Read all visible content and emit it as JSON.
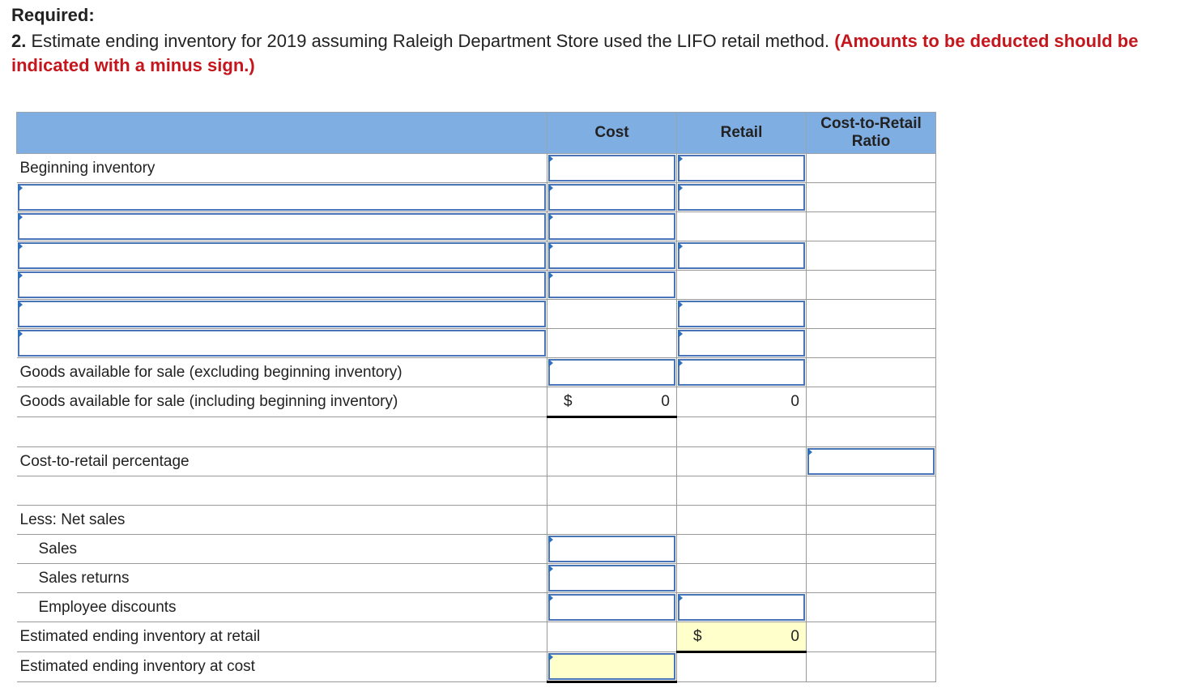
{
  "required": {
    "title": "Required:",
    "number": "2.",
    "text": " Estimate ending inventory for 2019 assuming Raleigh Department Store used the LIFO retail method. ",
    "note": "(Amounts to be deducted should be indicated with a minus sign.)"
  },
  "table": {
    "headers": {
      "cost": "Cost",
      "retail": "Retail",
      "ratio": "Cost-to-Retail Ratio"
    },
    "labels": {
      "beginning_inventory": "Beginning inventory",
      "goods_excl": "Goods available for sale (excluding beginning inventory)",
      "goods_incl": "Goods available for sale (including beginning inventory)",
      "cost_to_retail": "Cost-to-retail percentage",
      "less_net_sales": "Less: Net sales",
      "sales": "Sales",
      "sales_returns": "Sales returns",
      "employee_discounts": "Employee discounts",
      "est_retail": "Estimated ending inventory at retail",
      "est_cost": "Estimated ending inventory at cost"
    },
    "values": {
      "currency": "$",
      "goods_incl_cost": "0",
      "goods_incl_retail": "0",
      "est_retail_value": "0"
    }
  }
}
